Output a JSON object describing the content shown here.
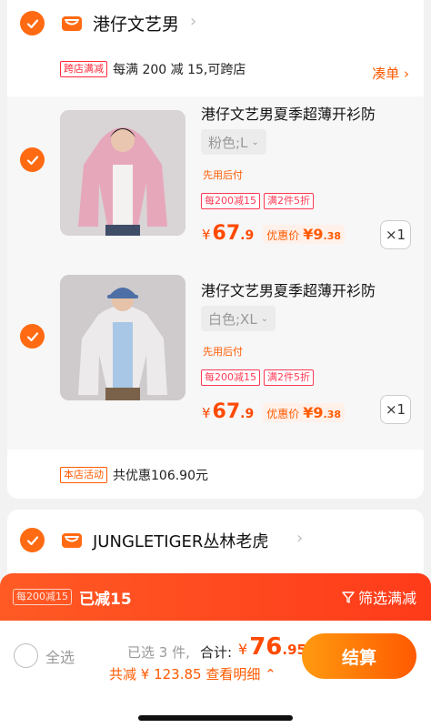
{
  "store1": {
    "name": "港仔文艺男",
    "promo_tag": "跨店满减",
    "promo_text": "每满 200 减 15,可跨店",
    "collect_label": "凑单 ›",
    "activity_tag": "本店活动",
    "activity_text": "共优惠106.90元"
  },
  "items": [
    {
      "title": "港仔文艺男夏季超薄开衫防",
      "sku": "粉色;L",
      "pay_later": "先用后付",
      "tags": [
        "每200减15",
        "满2件5折"
      ],
      "price_currency": "¥",
      "price_int": "67",
      "price_dec": ".9",
      "discount_label": "优惠价",
      "discount_int": "¥9",
      "discount_dec": ".38",
      "qty": "×1",
      "image_color": "pink"
    },
    {
      "title": "港仔文艺男夏季超薄开衫防",
      "sku": "白色;XL",
      "pay_later": "先用后付",
      "tags": [
        "每200减15",
        "满2件5折"
      ],
      "price_currency": "¥",
      "price_int": "67",
      "price_dec": ".9",
      "discount_label": "优惠价",
      "discount_int": "¥9",
      "discount_dec": ".38",
      "qty": "×1",
      "image_color": "white"
    }
  ],
  "store2": {
    "name": "JUNGLETIGER丛林老虎"
  },
  "discount_bar": {
    "tag": "每200减15",
    "text": "已减15",
    "filter_label": "筛选满减"
  },
  "bottom": {
    "select_all": "全选",
    "selected_count": "已选 3 件,",
    "total_label": "合计:",
    "total_currency": "¥",
    "total_int": "76",
    "total_dec": ".95",
    "saving_text": "共减 ¥ 123.85  查看明细 ⌃",
    "checkout_label": "结算"
  },
  "colors": {
    "accent": "#ff6a12",
    "price": "#ff4a00",
    "tag_red": "#ff2a3a",
    "bar_gradient_start": "#ff5a24",
    "bar_gradient_end": "#ff3b1a"
  }
}
